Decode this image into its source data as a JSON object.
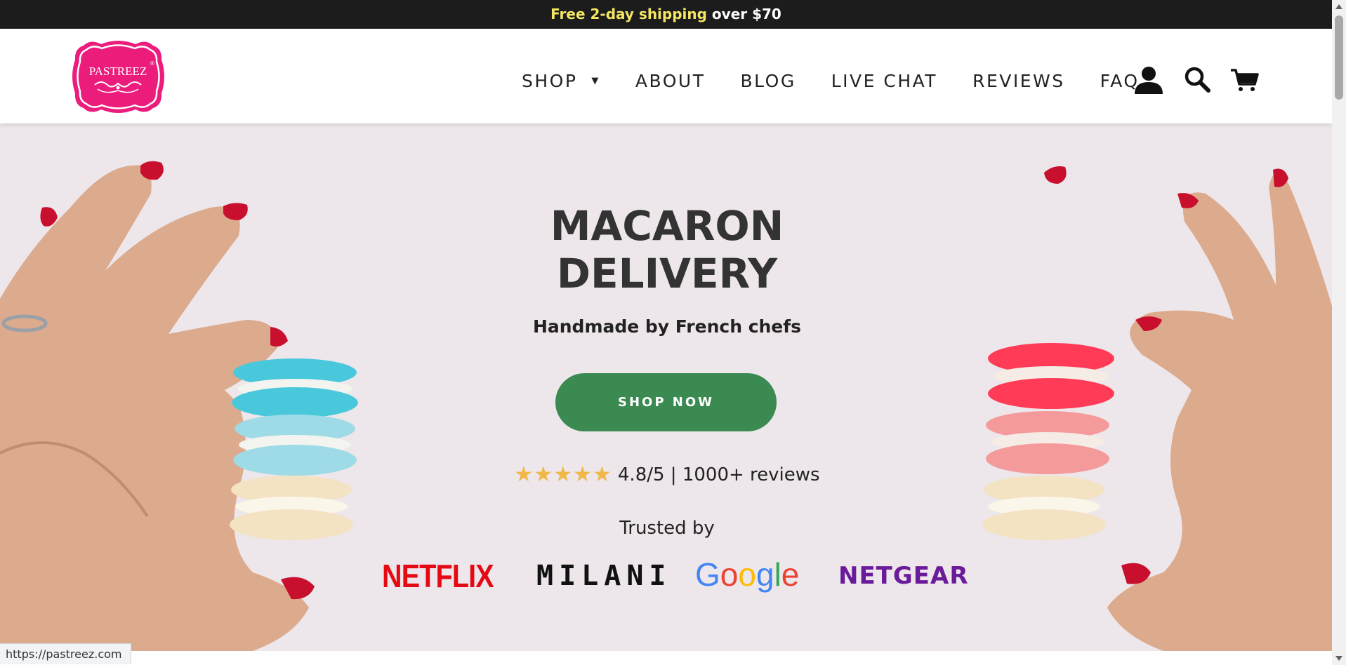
{
  "announcement": {
    "highlight": "Free 2-day shipping",
    "rest": " over $70"
  },
  "logo": {
    "text": "PASTREEZ",
    "mark": "®"
  },
  "nav": {
    "items": [
      {
        "label": "SHOP",
        "has_dropdown": true
      },
      {
        "label": "ABOUT"
      },
      {
        "label": "BLOG"
      },
      {
        "label": "LIVE CHAT"
      },
      {
        "label": "REVIEWS"
      },
      {
        "label": "FAQ"
      }
    ],
    "icons": [
      "account-icon",
      "search-icon",
      "cart-icon"
    ]
  },
  "hero": {
    "title_line1": "MACARON",
    "title_line2": "DELIVERY",
    "subtitle": "Handmade by French chefs",
    "cta": "SHOP NOW",
    "stars": "★★★★★",
    "rating_text": "4.8/5 | 1000+ reviews",
    "trusted_label": "Trusted by",
    "brands": [
      "NETFLIX",
      "MILANI",
      "Google",
      "NETGEAR"
    ]
  },
  "status_url": "https://pastreez.com",
  "colors": {
    "topbar": "#1c1c1c",
    "highlight": "#f5e663",
    "logo_pink": "#ec1c7d",
    "hero_bg": "#ede6ea",
    "cta_green": "#3b8a51",
    "star_gold": "#f0b849"
  }
}
